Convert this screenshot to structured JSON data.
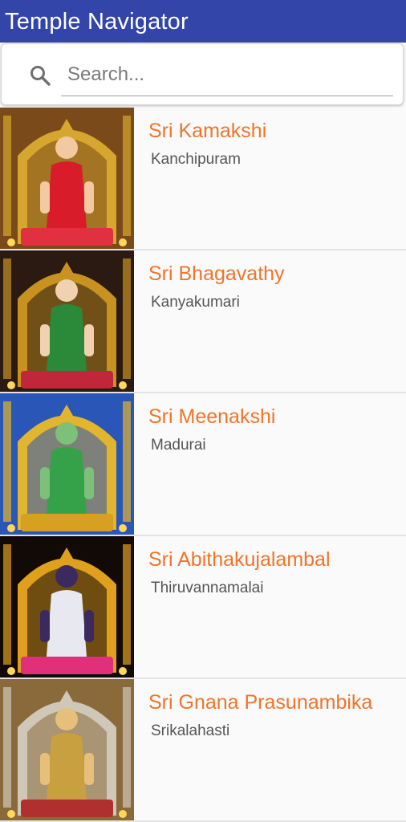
{
  "app": {
    "title": "Temple Navigator"
  },
  "search": {
    "placeholder": "Search...",
    "icon": "search-icon"
  },
  "temples": [
    {
      "name": "Sri Kamakshi",
      "place": "Kanchipuram",
      "colors": {
        "bg": "#7a4a1a",
        "frame": "#d6a62e",
        "robe": "#d81c2a",
        "skin": "#f2c9a0",
        "base": "#e23040"
      }
    },
    {
      "name": "Sri Bhagavathy",
      "place": "Kanyakumari",
      "colors": {
        "bg": "#2a1a12",
        "frame": "#c7921f",
        "robe": "#2a8a3a",
        "skin": "#f0d2b0",
        "base": "#c2263a"
      }
    },
    {
      "name": "Sri Meenakshi",
      "place": "Madurai",
      "colors": {
        "bg": "#2a56b8",
        "frame": "#e2b52e",
        "robe": "#35a24a",
        "skin": "#7cc07a",
        "base": "#d8a020"
      }
    },
    {
      "name": "Sri Abithakujalambal",
      "place": "Thiruvannamalai",
      "colors": {
        "bg": "#120a06",
        "frame": "#e0a01e",
        "robe": "#e8e8f0",
        "skin": "#3a2a60",
        "base": "#e0307a"
      }
    },
    {
      "name": "Sri Gnana Prasunambika",
      "place": "Srikalahasti",
      "colors": {
        "bg": "#8a6a3a",
        "frame": "#cfc7b8",
        "robe": "#c8a040",
        "skin": "#e6c07a",
        "base": "#b03030"
      }
    }
  ]
}
